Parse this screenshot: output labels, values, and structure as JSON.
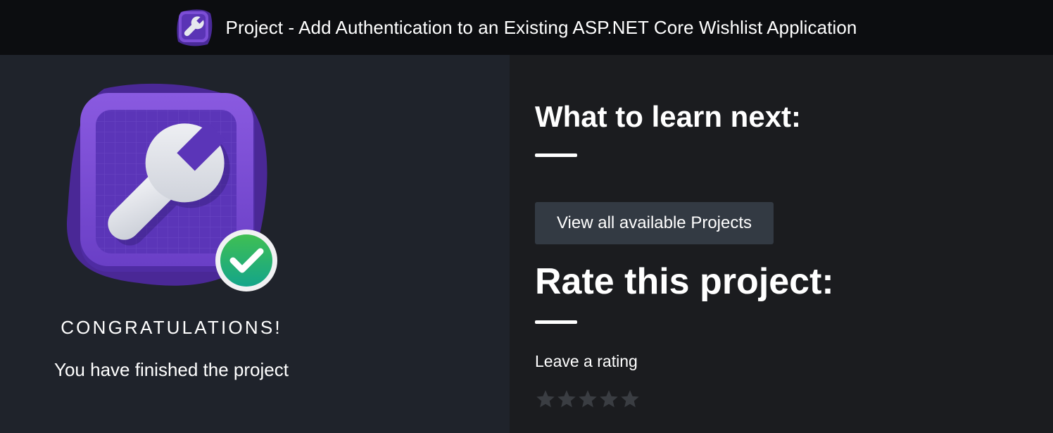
{
  "header": {
    "title": "Project - Add Authentication to an Existing ASP.NET Core Wishlist Application",
    "icon": "wrench-icon"
  },
  "completion": {
    "badge_icon": "wrench-icon",
    "status_icon": "checkmark-icon",
    "congrats_label": "CONGRATULATIONS!",
    "finished_message": "You have finished the project"
  },
  "next": {
    "heading": "What to learn next:",
    "button_label": "View all available Projects"
  },
  "rating": {
    "heading": "Rate this project:",
    "prompt": "Leave a rating",
    "max_stars": 5,
    "current_rating": 0
  },
  "colors": {
    "header_bg": "#0c0d10",
    "left_panel_bg": "#1f232b",
    "right_panel_bg": "#1b1c1f",
    "button_bg": "#333a43",
    "badge_purple": "#6b3fc4",
    "check_green": "#2fb55d",
    "star_empty": "#3a3d42"
  }
}
